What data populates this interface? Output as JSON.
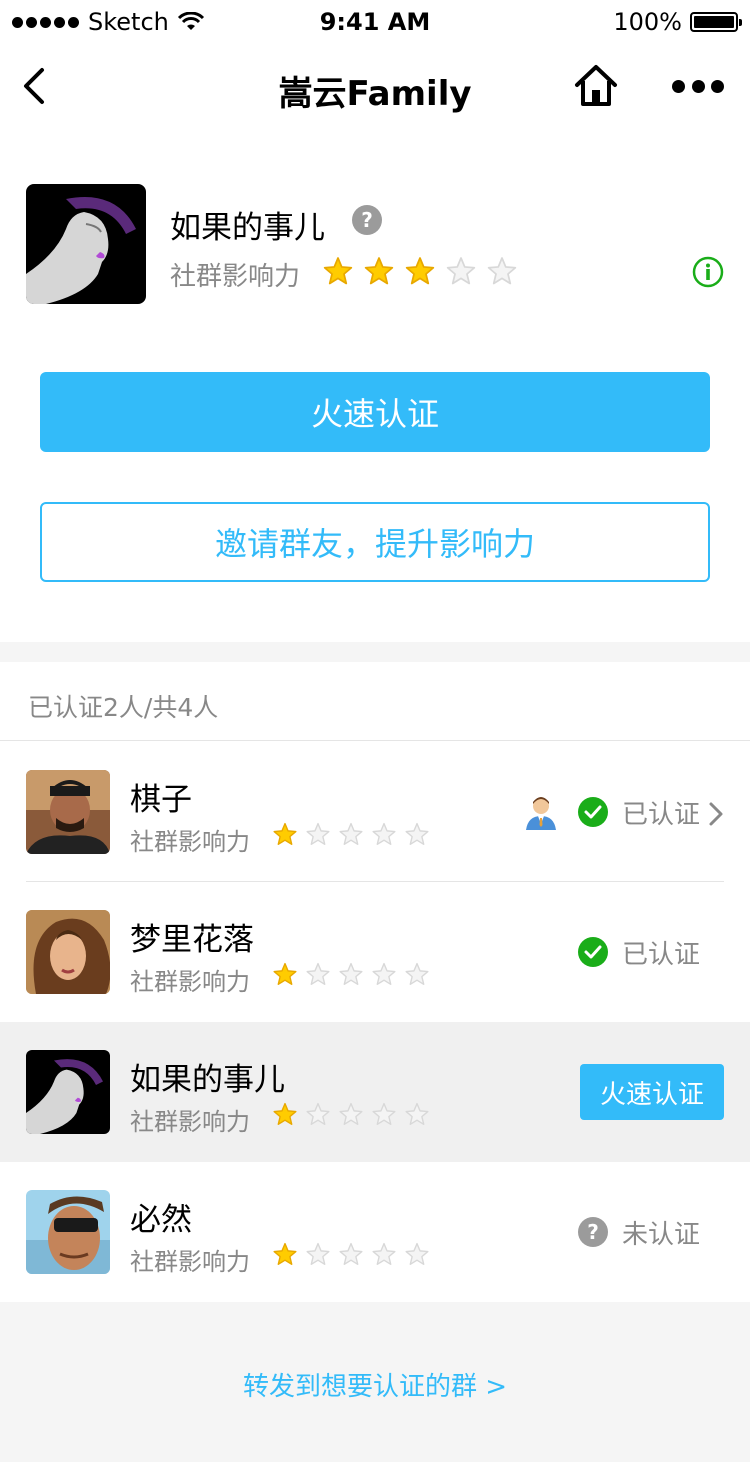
{
  "status_bar": {
    "carrier": "Sketch",
    "time": "9:41 AM",
    "battery": "100%"
  },
  "nav": {
    "title": "嵩云Family"
  },
  "group": {
    "name": "如果的事儿",
    "influence_label": "社群影响力",
    "rating": 3,
    "rating_max": 5
  },
  "actions": {
    "certify_label": "火速认证",
    "invite_label": "邀请群友，提升影响力"
  },
  "members": {
    "summary": "已认证2人/共4人",
    "list": [
      {
        "name": "棋子",
        "influence_label": "社群影响力",
        "rating": 1,
        "status": "已认证",
        "admin": true,
        "chevron": true
      },
      {
        "name": "梦里花落",
        "influence_label": "社群影响力",
        "rating": 1,
        "status": "已认证"
      },
      {
        "name": "如果的事儿",
        "influence_label": "社群影响力",
        "rating": 1,
        "action_label": "火速认证"
      },
      {
        "name": "必然",
        "influence_label": "社群影响力",
        "rating": 1,
        "status": "未认证"
      }
    ]
  },
  "footer": {
    "forward_link": "转发到想要认证的群 >"
  },
  "colors": {
    "accent": "#33bbf9",
    "verified": "#1aad19",
    "star": "#ffcc00"
  }
}
